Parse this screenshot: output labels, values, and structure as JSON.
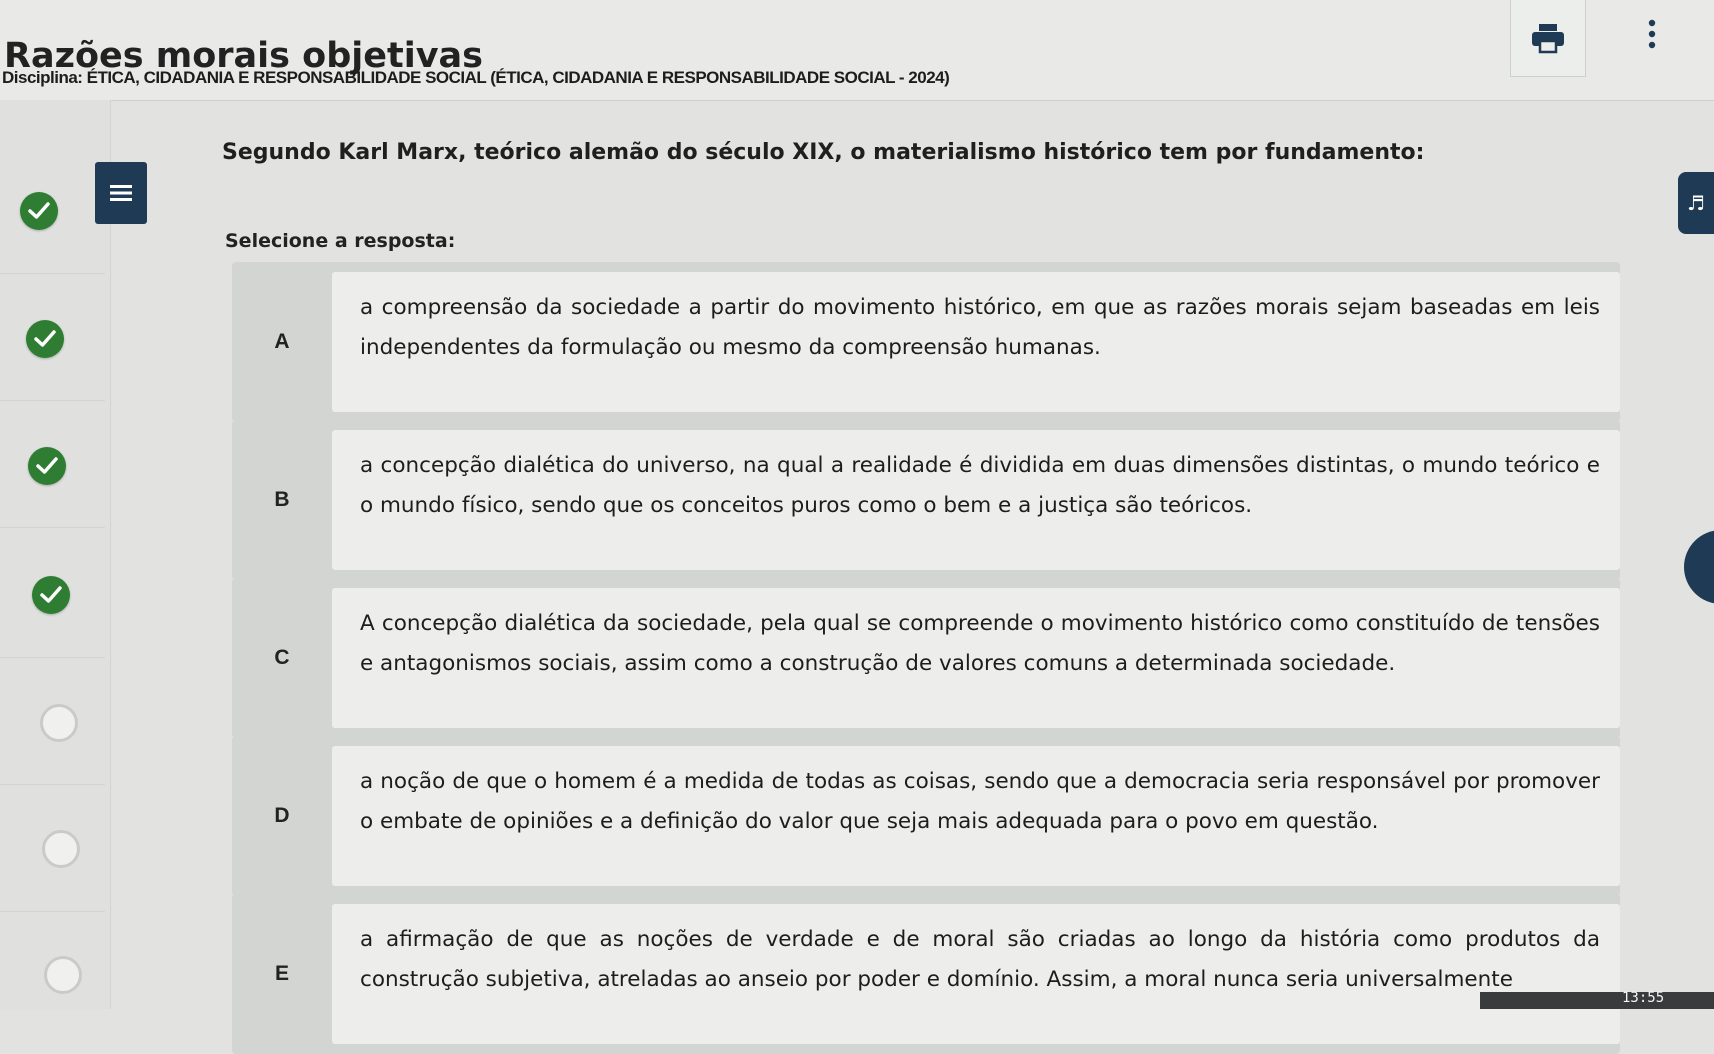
{
  "header": {
    "title": "Razões morais objetivas",
    "subtitle": "Disciplina: ÉTICA, CIDADANIA E RESPONSABILIDADE SOCIAL (ÉTICA, CIDADANIA E RESPONSABILIDADE SOCIAL - 2024)",
    "print_icon": "printer-icon",
    "more_icon": "more-vertical-icon"
  },
  "nav": {
    "items": [
      {
        "status": "answered"
      },
      {
        "status": "answered"
      },
      {
        "status": "answered"
      },
      {
        "status": "answered"
      },
      {
        "status": "unanswered"
      },
      {
        "status": "unanswered"
      },
      {
        "status": "unanswered"
      }
    ],
    "menu_icon": "hamburger-menu-icon"
  },
  "question": {
    "text": "Segundo Karl Marx, teórico alemão do século XIX, o materialismo histórico tem por fundamento:",
    "select_label": "Selecione a resposta:",
    "options": [
      {
        "letter": "A",
        "text": "a compreensão da sociedade a partir do movimento histórico, em que as razões morais sejam baseadas em leis independentes da formulação ou mesmo da compreensão humanas."
      },
      {
        "letter": "B",
        "text": "a concepção dialética do universo, na qual a realidade é dividida em duas dimensões distintas, o mundo teórico e o mundo físico, sendo que os conceitos puros como o bem e a justiça são teóricos."
      },
      {
        "letter": "C",
        "text": "A concepção dialética da sociedade, pela qual se compreende o movimento histórico como constituído de tensões e antagonismos sociais, assim como a construção de valores comuns a determinada sociedade."
      },
      {
        "letter": "D",
        "text": "a noção de que o homem é a medida de todas as coisas, sendo que a democracia seria responsável por promover o embate de opiniões e a definição do valor que seja mais adequada para o povo em questão."
      },
      {
        "letter": "E",
        "text": "a afirmação de que as noções de verdade e de moral são criadas ao longo da história como produtos da construção subjetiva, atreladas ao anseio por poder e domínio. Assim, a moral nunca seria universalmente"
      }
    ]
  },
  "colors": {
    "check_green": "#2e7d32",
    "navy": "#1f3a55"
  },
  "clock": "13:55"
}
